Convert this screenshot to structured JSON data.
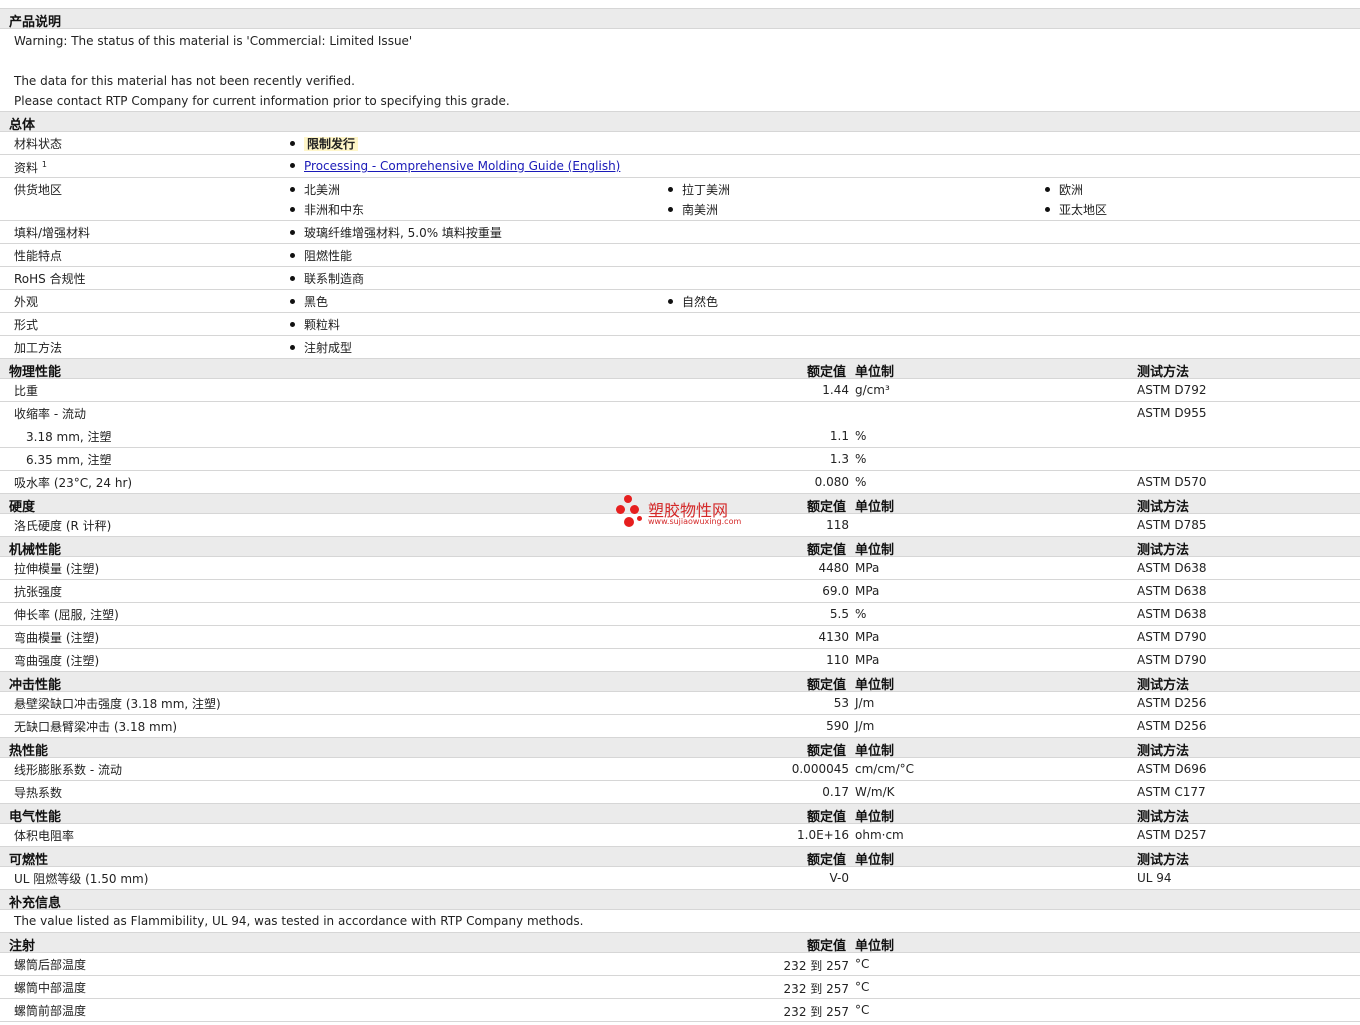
{
  "product_desc": {
    "title": "产品说明",
    "warning": "Warning: The status of this material is 'Commercial: Limited Issue'",
    "line2": "The data for this material has not been recently verified.",
    "line3": "Please contact RTP Company for current information prior to specifying this grade."
  },
  "general": {
    "title": "总体",
    "status_label": "材料状态",
    "status_value": "限制发行",
    "docs_label": "资料",
    "docs_sup": "1",
    "docs_link": "Processing - Comprehensive Molding Guide (English)",
    "region_label": "供货地区",
    "regions": [
      "北美洲",
      "拉丁美洲",
      "欧洲",
      "非洲和中东",
      "南美洲",
      "亚太地区"
    ],
    "filler_label": "填料/增强材料",
    "filler_value": "玻璃纤维增强材料, 5.0% 填料按重量",
    "features_label": "性能特点",
    "features_value": "阻燃性能",
    "rohs_label": "RoHS 合规性",
    "rohs_value": "联系制造商",
    "appearance_label": "外观",
    "appearance_values": [
      "黑色",
      "自然色"
    ],
    "form_label": "形式",
    "form_value": "颗粒料",
    "process_label": "加工方法",
    "process_value": "注射成型"
  },
  "columns": {
    "nominal": "额定值",
    "unit": "单位制",
    "method": "测试方法"
  },
  "physical": {
    "title": "物理性能",
    "rows": [
      {
        "label": "比重",
        "value": "1.44",
        "unit": "g/cm³",
        "method": "ASTM D792"
      },
      {
        "label": "收缩率  - 流动",
        "value": "",
        "unit": "",
        "method": "ASTM D955"
      },
      {
        "label": "3.18 mm, 注塑",
        "value": "1.1",
        "unit": "%",
        "method": ""
      },
      {
        "label": "6.35 mm, 注塑",
        "value": "1.3",
        "unit": "%",
        "method": ""
      },
      {
        "label": "吸水率  (23°C, 24 hr)",
        "value": "0.080",
        "unit": "%",
        "method": "ASTM D570"
      }
    ]
  },
  "hardness": {
    "title": "硬度",
    "rows": [
      {
        "label": "洛氏硬度  (R 计秤)",
        "value": "118",
        "unit": "",
        "method": "ASTM D785"
      }
    ]
  },
  "mechanical": {
    "title": "机械性能",
    "rows": [
      {
        "label": "拉伸模量  (注塑)",
        "value": "4480",
        "unit": "MPa",
        "method": "ASTM D638"
      },
      {
        "label": "抗张强度",
        "value": "69.0",
        "unit": "MPa",
        "method": "ASTM D638"
      },
      {
        "label": "伸长率  (屈服, 注塑)",
        "value": "5.5",
        "unit": "%",
        "method": "ASTM D638"
      },
      {
        "label": "弯曲模量  (注塑)",
        "value": "4130",
        "unit": "MPa",
        "method": "ASTM D790"
      },
      {
        "label": "弯曲强度  (注塑)",
        "value": "110",
        "unit": "MPa",
        "method": "ASTM D790"
      }
    ]
  },
  "impact": {
    "title": "冲击性能",
    "rows": [
      {
        "label": "悬壁梁缺口冲击强度  (3.18 mm, 注塑)",
        "value": "53",
        "unit": "J/m",
        "method": "ASTM D256"
      },
      {
        "label": "无缺口悬臂梁冲击  (3.18 mm)",
        "value": "590",
        "unit": "J/m",
        "method": "ASTM D256"
      }
    ]
  },
  "thermal": {
    "title": "热性能",
    "rows": [
      {
        "label": "线形膨胀系数  - 流动",
        "value": "0.000045",
        "unit": "cm/cm/°C",
        "method": "ASTM D696"
      },
      {
        "label": "导热系数",
        "value": "0.17",
        "unit": "W/m/K",
        "method": "ASTM C177"
      }
    ]
  },
  "electrical": {
    "title": "电气性能",
    "rows": [
      {
        "label": "体积电阻率",
        "value": "1.0E+16",
        "unit": "ohm·cm",
        "method": "ASTM D257"
      }
    ]
  },
  "flammability": {
    "title": "可燃性",
    "rows": [
      {
        "label": "UL 阻燃等级  (1.50 mm)",
        "value": "V-0",
        "unit": "",
        "method": "UL 94"
      }
    ]
  },
  "supplement": {
    "title": "补充信息",
    "text": "The value listed as Flammibility, UL 94, was tested in accordance with RTP Company methods."
  },
  "injection": {
    "title": "注射",
    "rows": [
      {
        "label": "螺筒后部温度",
        "value": "232 到  257",
        "unit": "°C"
      },
      {
        "label": "螺筒中部温度",
        "value": "232 到  257",
        "unit": "°C"
      },
      {
        "label": "螺筒前部温度",
        "value": "232 到  257",
        "unit": "°C"
      }
    ]
  },
  "watermark": {
    "name": "塑胶物性网",
    "url": "www.sujiaowuxing.com"
  }
}
